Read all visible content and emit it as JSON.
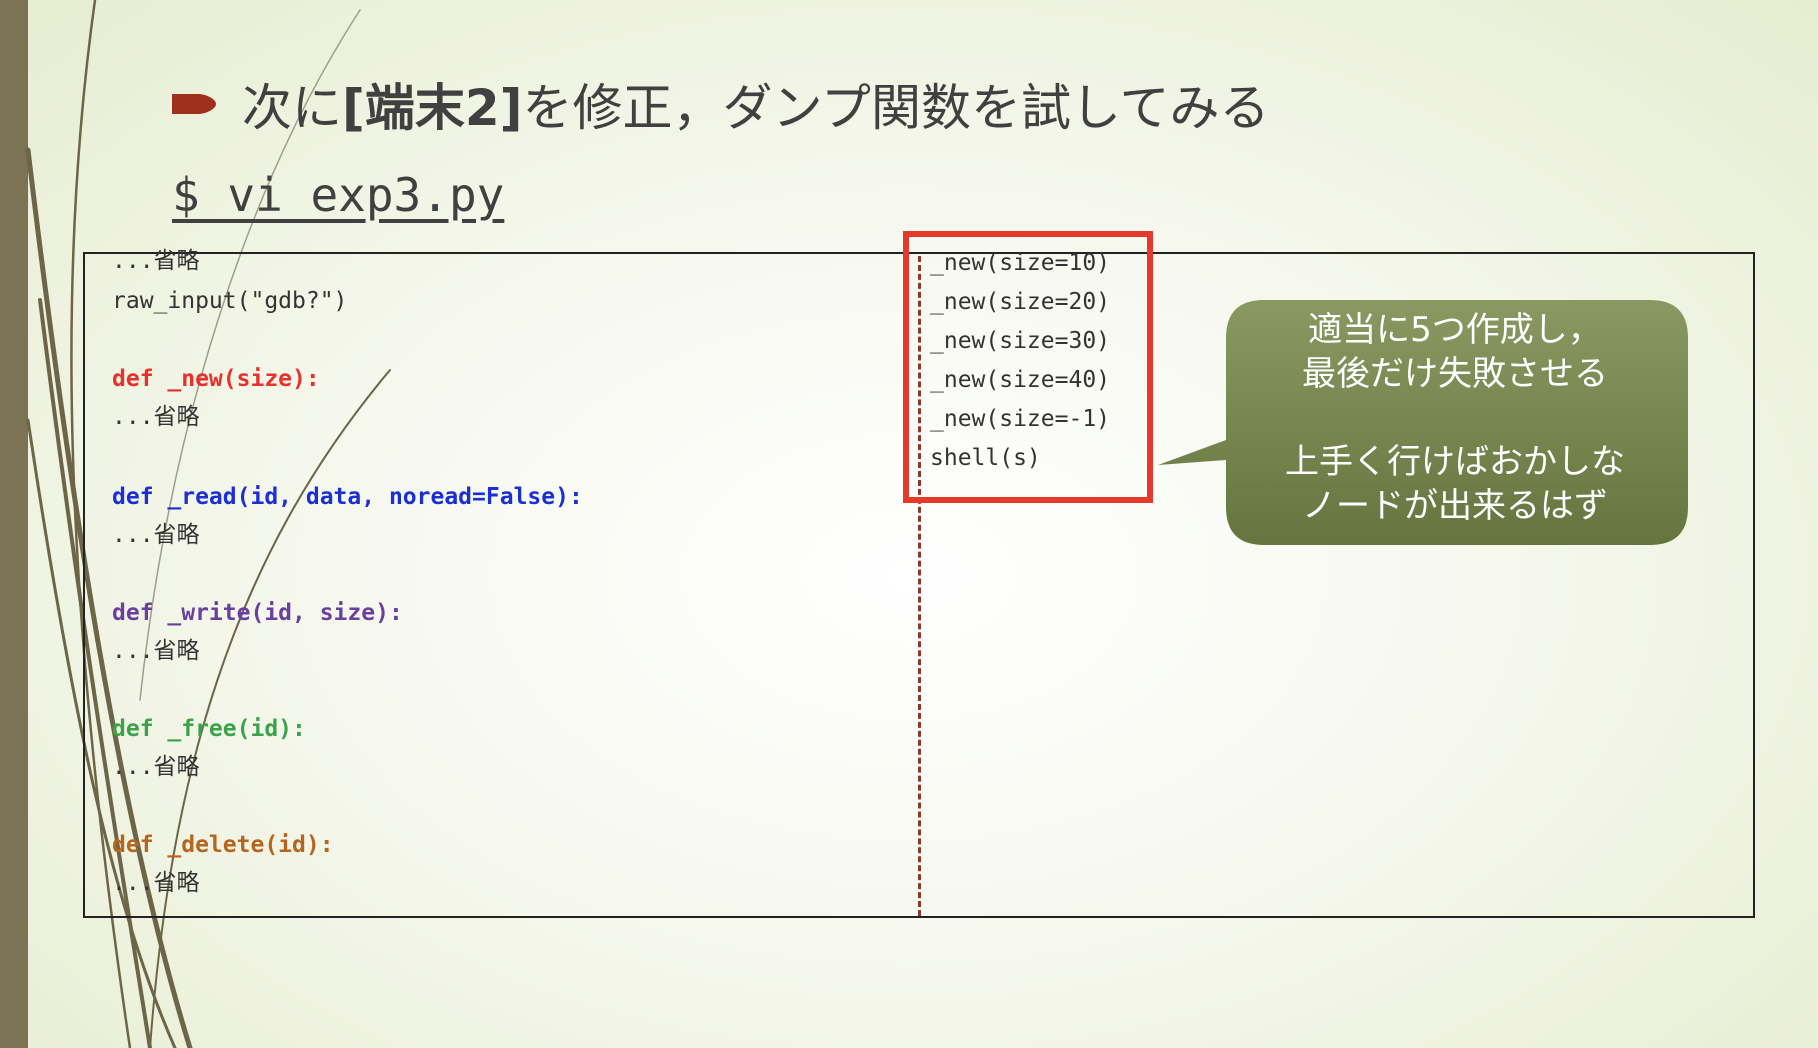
{
  "title": {
    "prefix": "次に",
    "bold": "[端末2]",
    "suffix": "を修正，ダンプ関数を試してみる"
  },
  "command": "$ vi exp3.py",
  "code_left": [
    {
      "text": "...省略",
      "color": "#333333",
      "def": false
    },
    {
      "text": "raw_input(\"gdb?\")",
      "color": "#333333",
      "def": false
    },
    {
      "text": "def _new(size):",
      "color": "#e8312a",
      "def": true
    },
    {
      "text": "...省略",
      "color": "#333333",
      "def": false
    },
    {
      "text": "def _read(id, data, noread=False):",
      "color": "#1a2fd6",
      "def": true
    },
    {
      "text": "...省略",
      "color": "#333333",
      "def": false
    },
    {
      "text": "def _write(id, size):",
      "color": "#6b3fa0",
      "def": true
    },
    {
      "text": "...省略",
      "color": "#333333",
      "def": false
    },
    {
      "text": "def _free(id):",
      "color": "#3aa34a",
      "def": true
    },
    {
      "text": "...省略",
      "color": "#333333",
      "def": false
    },
    {
      "text": "def _delete(id):",
      "color": "#b5651d",
      "def": true
    },
    {
      "text": "...省略",
      "color": "#333333",
      "def": false
    }
  ],
  "code_right": [
    "_new(size=10)",
    "_new(size=20)",
    "_new(size=30)",
    "_new(size=40)",
    "_new(size=-1)",
    "shell(s)"
  ],
  "callout": {
    "line1": "適当に5つ作成し，",
    "line2": "最後だけ失敗させる",
    "line3": "上手く行けばおかしな",
    "line4": "ノードが出来るはず"
  },
  "colors": {
    "bullet": "#a0301e",
    "highlight": "#e4392b",
    "callout": "#6f7d4c",
    "sidebar": "#7b7353"
  }
}
